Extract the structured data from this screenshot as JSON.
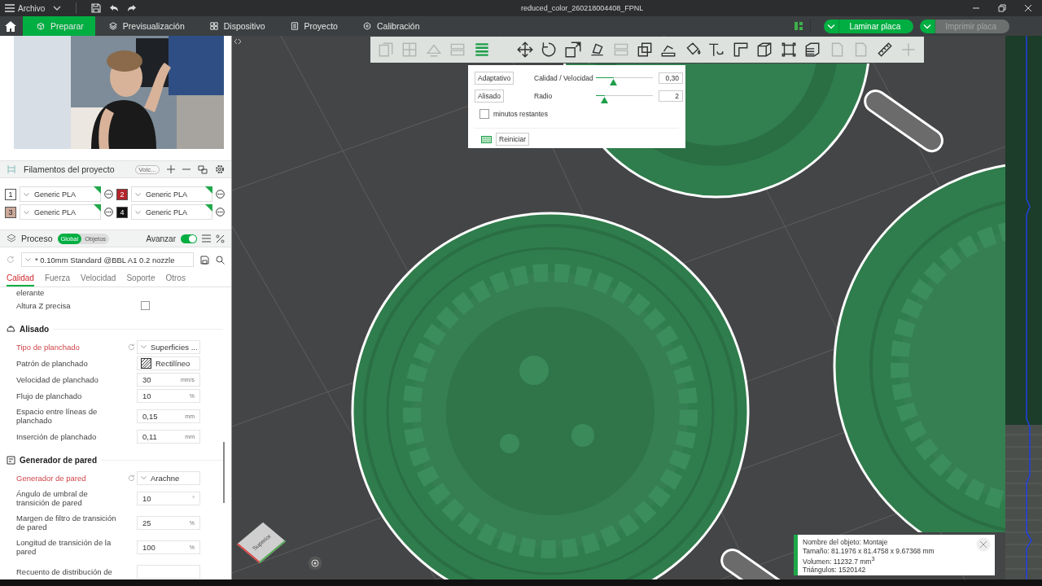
{
  "window": {
    "menu": "Archivo",
    "title": "reduced_color_260218004408_FPNL"
  },
  "tabs": [
    {
      "label": "Preparar",
      "selected": true
    },
    {
      "label": "Previsualización",
      "selected": false
    },
    {
      "label": "Dispositivo",
      "selected": false
    },
    {
      "label": "Proyecto",
      "selected": false
    },
    {
      "label": "Calibración",
      "selected": false
    }
  ],
  "actions": [
    {
      "label": "Laminar placa",
      "disabled": false
    },
    {
      "label": "Imprimir placa",
      "disabled": true
    }
  ],
  "filaments": {
    "title": "Filamentos del proyecto",
    "badge": "Volc...",
    "items": [
      {
        "number": "1",
        "color": "#ffffff",
        "name": "Generic PLA"
      },
      {
        "number": "2",
        "color": "#b3242a",
        "name": "Generic PLA"
      },
      {
        "number": "3",
        "color": "#cda99a",
        "name": "Generic PLA"
      },
      {
        "number": "4",
        "color": "#111111",
        "name": "Generic PLA"
      }
    ]
  },
  "process": {
    "title": "Proceso",
    "scope": [
      {
        "label": "Global",
        "selected": true
      },
      {
        "label": "Objetos",
        "selected": false
      }
    ],
    "advanced": {
      "label": "Avanzar",
      "on": true
    },
    "preset": "* 0.10mm Standard @BBL A1 0.2 nozzle",
    "tabs": [
      {
        "label": "Calidad",
        "selected": true
      },
      {
        "label": "Fuerza",
        "selected": false
      },
      {
        "label": "Velocidad",
        "selected": false
      },
      {
        "label": "Soporte",
        "selected": false
      },
      {
        "label": "Otros",
        "selected": false
      }
    ]
  },
  "settings": [
    {
      "kind": "label",
      "label": "elerante"
    },
    {
      "kind": "checkbox",
      "label": "Altura Z precisa",
      "checked": false
    },
    {
      "kind": "section",
      "label": "Alisado"
    },
    {
      "kind": "dropdown",
      "label": "Tipo de planchado",
      "value": "Superficies ...",
      "modified": true
    },
    {
      "kind": "pattern",
      "label": "Patrón de planchado",
      "value": "Rectilíneo",
      "modified": false
    },
    {
      "kind": "number",
      "label": "Velocidad de planchado",
      "value": "30",
      "unit": "mm/s",
      "modified": false
    },
    {
      "kind": "number",
      "label": "Flujo de planchado",
      "value": "10",
      "unit": "%",
      "modified": false
    },
    {
      "kind": "number",
      "label": "Espacio entre líneas de planchado",
      "value": "0,15",
      "unit": "mm",
      "modified": false
    },
    {
      "kind": "number",
      "label": "Inserción de planchado",
      "value": "0,11",
      "unit": "mm",
      "modified": false
    },
    {
      "kind": "section",
      "label": "Generador de pared"
    },
    {
      "kind": "dropdown",
      "label": "Generador de pared",
      "value": "Arachne",
      "modified": true
    },
    {
      "kind": "number",
      "label": "Ángulo de umbral de transición de pared",
      "value": "10",
      "unit": "°",
      "modified": false
    },
    {
      "kind": "number",
      "label": "Margen de filtro de transición de pared",
      "value": "25",
      "unit": "%",
      "modified": false
    },
    {
      "kind": "number",
      "label": "Longitud de transición de la pared",
      "value": "100",
      "unit": "%",
      "modified": false
    },
    {
      "kind": "number",
      "label": "Recuento de distribución de",
      "modified": false
    }
  ],
  "toolbar": [
    {
      "selected": false,
      "disabled": true
    },
    {
      "selected": false,
      "disabled": true
    },
    {
      "selected": false,
      "disabled": true
    },
    {
      "selected": false,
      "disabled": true
    },
    {
      "selected": true,
      "disabled": false
    },
    {
      "selected": false,
      "disabled": false
    },
    {
      "selected": false,
      "disabled": false
    },
    {
      "selected": false,
      "disabled": false
    },
    {
      "selected": false,
      "disabled": false
    },
    {
      "selected": false,
      "disabled": true
    },
    {
      "selected": false,
      "disabled": false
    },
    {
      "selected": false,
      "disabled": false
    },
    {
      "selected": false,
      "disabled": false
    },
    {
      "selected": false,
      "disabled": false
    },
    {
      "selected": false,
      "disabled": false
    },
    {
      "selected": false,
      "disabled": false
    },
    {
      "selected": false,
      "disabled": false
    },
    {
      "selected": false,
      "disabled": false
    },
    {
      "selected": false,
      "disabled": true
    },
    {
      "selected": false,
      "disabled": true
    },
    {
      "selected": false,
      "disabled": false
    },
    {
      "selected": false,
      "disabled": true
    }
  ],
  "layer_popup": {
    "rows": [
      {
        "button": "Adaptativo",
        "label": "Calidad / Velocidad",
        "level": 0.31,
        "value": "0,30"
      },
      {
        "button": "Alisado",
        "label": "Radio",
        "level": 0.15,
        "value": "2"
      }
    ],
    "checkbox": {
      "label": "minutos restantes",
      "checked": false
    },
    "reset": "Reiniciar"
  },
  "view_cube": {
    "label": "Superior"
  },
  "object_info": {
    "lines": [
      "Nombre del objeto: Montaje",
      "Tamaño: 81.1976 x 81.4758 x 9.67368 mm",
      "Volumen: 11232.7 mm$^{3}$",
      "Triángulos: 1520142"
    ]
  }
}
